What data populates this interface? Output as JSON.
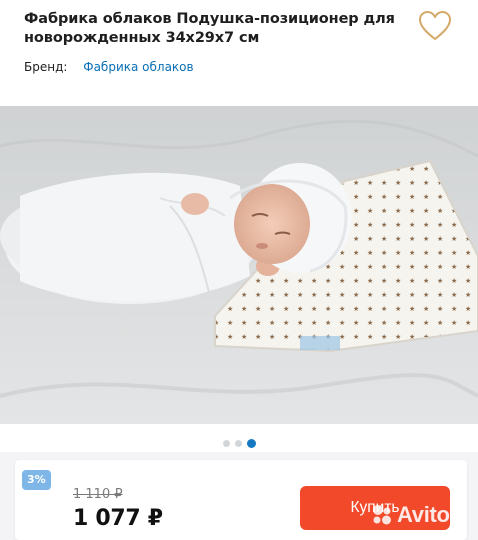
{
  "product": {
    "title": "Фабрика облаков Подушка-позиционер для новорожденных 34x29x7 см",
    "brand_label": "Бренд:",
    "brand_name": "Фабрика облаков"
  },
  "favorite": {
    "icon": "heart-outline-icon",
    "color": "#d4a96a"
  },
  "gallery": {
    "image": "newborn-on-star-pillow-photo",
    "slides_total": 3,
    "active_slide": 3
  },
  "purchase": {
    "discount_badge": "3%",
    "old_price": "1 110 ₽",
    "price": "1 077 ₽",
    "buy_label": "Купить",
    "button_color": "#f2492a"
  },
  "watermark": {
    "text": "Avito",
    "icon": "avito-dots-icon"
  }
}
